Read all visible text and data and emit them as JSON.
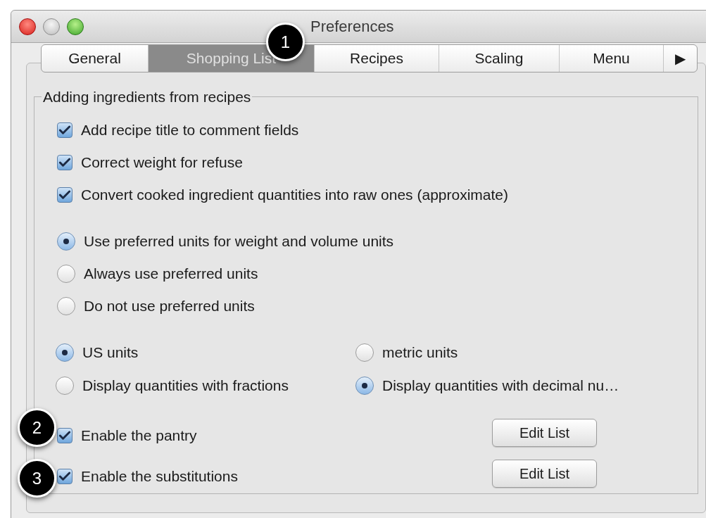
{
  "window": {
    "title": "Preferences"
  },
  "tabs": [
    {
      "label": "General",
      "selected": false
    },
    {
      "label": "Shopping List",
      "selected": true
    },
    {
      "label": "Recipes",
      "selected": false
    },
    {
      "label": "Scaling",
      "selected": false
    },
    {
      "label": "Menu",
      "selected": false
    }
  ],
  "tab_overflow": "▶",
  "group": {
    "title": "Adding ingredients from recipes",
    "checkboxes": [
      {
        "label": "Add recipe title to comment fields",
        "checked": true
      },
      {
        "label": "Correct weight for refuse",
        "checked": true
      },
      {
        "label": "Convert cooked ingredient quantities into raw ones (approximate)",
        "checked": true
      }
    ],
    "unit_preference": [
      {
        "label": "Use preferred units for weight and volume units",
        "selected": true
      },
      {
        "label": "Always use preferred units",
        "selected": false
      },
      {
        "label": "Do not use preferred units",
        "selected": false
      }
    ],
    "unit_system": [
      {
        "label": "US units",
        "selected": true
      },
      {
        "label": "metric units",
        "selected": false
      }
    ],
    "quantity_display": [
      {
        "label": "Display quantities with fractions",
        "selected": false
      },
      {
        "label": "Display quantities with decimal nu…",
        "selected": true
      }
    ],
    "lists": [
      {
        "label": "Enable the pantry",
        "checked": true,
        "button": "Edit List"
      },
      {
        "label": "Enable the substitutions",
        "checked": true,
        "button": "Edit List"
      }
    ]
  },
  "callouts": [
    "1",
    "2",
    "3"
  ]
}
